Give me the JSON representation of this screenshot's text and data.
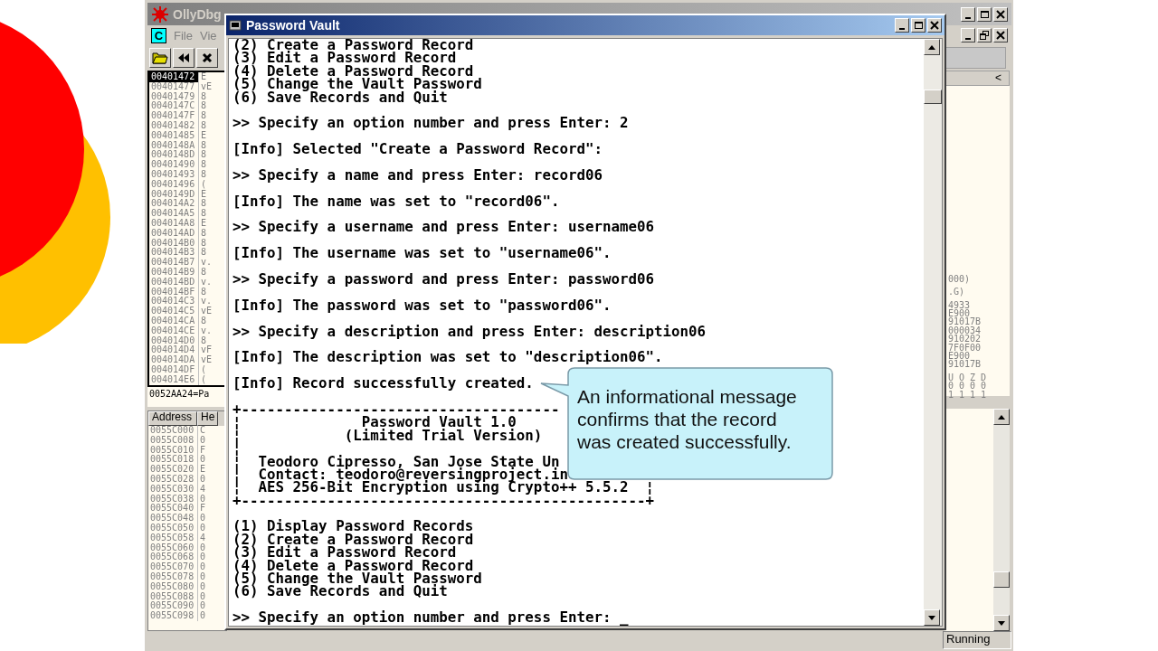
{
  "debugger": {
    "title": "OllyDbg",
    "menu": {
      "app_icon_label": "C",
      "items": [
        "File",
        "Vie"
      ]
    },
    "cpu_rows": [
      {
        "address": "00401472",
        "code": "E",
        "selected": true
      },
      {
        "address": "00401477",
        "code": "vE",
        "selected": false
      },
      {
        "address": "00401479",
        "code": "8",
        "selected": false
      },
      {
        "address": "0040147C",
        "code": "8",
        "selected": false
      },
      {
        "address": "0040147F",
        "code": "8",
        "selected": false
      },
      {
        "address": "00401482",
        "code": "8",
        "selected": false
      },
      {
        "address": "00401485",
        "code": "E",
        "selected": false
      },
      {
        "address": "0040148A",
        "code": "8",
        "selected": false
      },
      {
        "address": "0040148D",
        "code": "8",
        "selected": false
      },
      {
        "address": "00401490",
        "code": "8",
        "selected": false
      },
      {
        "address": "00401493",
        "code": "8",
        "selected": false
      },
      {
        "address": "00401496",
        "code": "(",
        "selected": false
      },
      {
        "address": "0040149D",
        "code": "E",
        "selected": false
      },
      {
        "address": "004014A2",
        "code": "8",
        "selected": false
      },
      {
        "address": "004014A5",
        "code": "8",
        "selected": false
      },
      {
        "address": "004014A8",
        "code": "E",
        "selected": false
      },
      {
        "address": "004014AD",
        "code": "8",
        "selected": false
      },
      {
        "address": "004014B0",
        "code": "8",
        "selected": false
      },
      {
        "address": "004014B3",
        "code": "8",
        "selected": false
      },
      {
        "address": "004014B7",
        "code": "v.",
        "selected": false
      },
      {
        "address": "004014B9",
        "code": "8",
        "selected": false
      },
      {
        "address": "004014BD",
        "code": "v.",
        "selected": false
      },
      {
        "address": "004014BF",
        "code": "8",
        "selected": false
      },
      {
        "address": "004014C3",
        "code": "v.",
        "selected": false
      },
      {
        "address": "004014C5",
        "code": "vE",
        "selected": false
      },
      {
        "address": "004014CA",
        "code": "8",
        "selected": false
      },
      {
        "address": "004014CE",
        "code": "v.",
        "selected": false
      },
      {
        "address": "004014D0",
        "code": "8",
        "selected": false
      },
      {
        "address": "004014D4",
        "code": "vF",
        "selected": false
      },
      {
        "address": "004014DA",
        "code": "vE",
        "selected": false
      },
      {
        "address": "004014DF",
        "code": "(",
        "selected": false
      },
      {
        "address": "004014E6",
        "code": "(",
        "selected": false
      }
    ],
    "info_line": "0052AA24=Pa",
    "dump_columns": [
      "Address",
      "He"
    ],
    "dump_rows": [
      {
        "address": "0055C000",
        "hex": "C"
      },
      {
        "address": "0055C008",
        "hex": "0"
      },
      {
        "address": "0055C010",
        "hex": "F"
      },
      {
        "address": "0055C018",
        "hex": "0"
      },
      {
        "address": "0055C020",
        "hex": "E"
      },
      {
        "address": "0055C028",
        "hex": "0"
      },
      {
        "address": "0055C030",
        "hex": "4"
      },
      {
        "address": "0055C038",
        "hex": "0"
      },
      {
        "address": "0055C040",
        "hex": "F"
      },
      {
        "address": "0055C048",
        "hex": "0"
      },
      {
        "address": "0055C050",
        "hex": "0"
      },
      {
        "address": "0055C058",
        "hex": "4"
      },
      {
        "address": "0055C060",
        "hex": "0"
      },
      {
        "address": "0055C068",
        "hex": "0"
      },
      {
        "address": "0055C070",
        "hex": "0"
      },
      {
        "address": "0055C078",
        "hex": "0"
      },
      {
        "address": "0055C080",
        "hex": "0"
      },
      {
        "address": "0055C088",
        "hex": "0"
      },
      {
        "address": "0055C090",
        "hex": "0"
      },
      {
        "address": "0055C098",
        "hex": "0"
      }
    ],
    "register_header": "<",
    "register_groups": [
      [
        "000)"
      ],
      [
        ".G)"
      ],
      [
        "4933",
        "E900",
        "91017B",
        "000034",
        "910202",
        "7F0F00",
        "E900",
        "91017B"
      ],
      [
        "U O Z D",
        "0 0 0 0",
        "1 1 1 1"
      ]
    ],
    "status": "Running"
  },
  "console": {
    "title": "Password Vault",
    "blocks": [
      [
        "(2) Create a Password Record",
        "(3) Edit a Password Record",
        "(4) Delete a Password Record",
        "(5) Change the Vault Password",
        "(6) Save Records and Quit"
      ],
      [
        ">> Specify an option number and press Enter: 2"
      ],
      [
        "[Info] Selected \"Create a Password Record\":"
      ],
      [
        ">> Specify a name and press Enter: record06"
      ],
      [
        "[Info] The name was set to \"record06\"."
      ],
      [
        ">> Specify a username and press Enter: username06"
      ],
      [
        "[Info] The username was set to \"username06\"."
      ],
      [
        ">> Specify a password and press Enter: password06"
      ],
      [
        "[Info] The password was set to \"password06\"."
      ],
      [
        ">> Specify a description and press Enter: description06"
      ],
      [
        "[Info] The description was set to \"description06\"."
      ],
      [
        "[Info] Record successfully created."
      ],
      [
        "+-------------------------------------",
        "¦              Password Vault 1.0",
        "¦            (Limited Trial Version)",
        "¦",
        "¦  Teodoro Cipresso, San Jose State Un",
        "¦  Contact: teodoro@reversingproject.in",
        "¦  AES 256-Bit Encryption using Crypto++ 5.5.2  ¦",
        "+-----------------------------------------------+"
      ],
      [
        "(1) Display Password Records",
        "(2) Create a Password Record",
        "(3) Edit a Password Record",
        "(4) Delete a Password Record",
        "(5) Change the Vault Password",
        "(6) Save Records and Quit"
      ],
      [
        ">> Specify an option number and press Enter: _"
      ]
    ]
  },
  "callout": {
    "text": "An informational message confirms that the record was created successfully."
  }
}
